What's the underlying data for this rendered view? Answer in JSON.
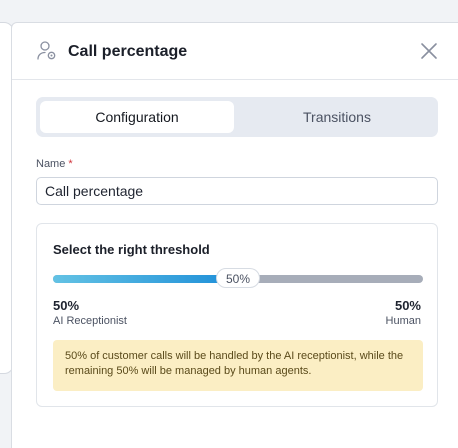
{
  "header": {
    "title": "Call percentage",
    "icon": "user-settings-icon"
  },
  "tabs": [
    {
      "label": "Configuration",
      "active": true
    },
    {
      "label": "Transitions",
      "active": false
    }
  ],
  "form": {
    "name_label": "Name",
    "required_mark": "*",
    "name_value": "Call percentage"
  },
  "threshold": {
    "title": "Select the right threshold",
    "value_percent": 50,
    "thumb_label": "50%",
    "left": {
      "percent": "50%",
      "label": "AI Receptionist"
    },
    "right": {
      "percent": "50%",
      "label": "Human"
    },
    "note": "50% of customer calls will be handled by the AI receptionist, while the remaining 50% will be managed by human agents."
  },
  "colors": {
    "accent": "#1d8ed8",
    "note_bg": "#fbeec4"
  }
}
